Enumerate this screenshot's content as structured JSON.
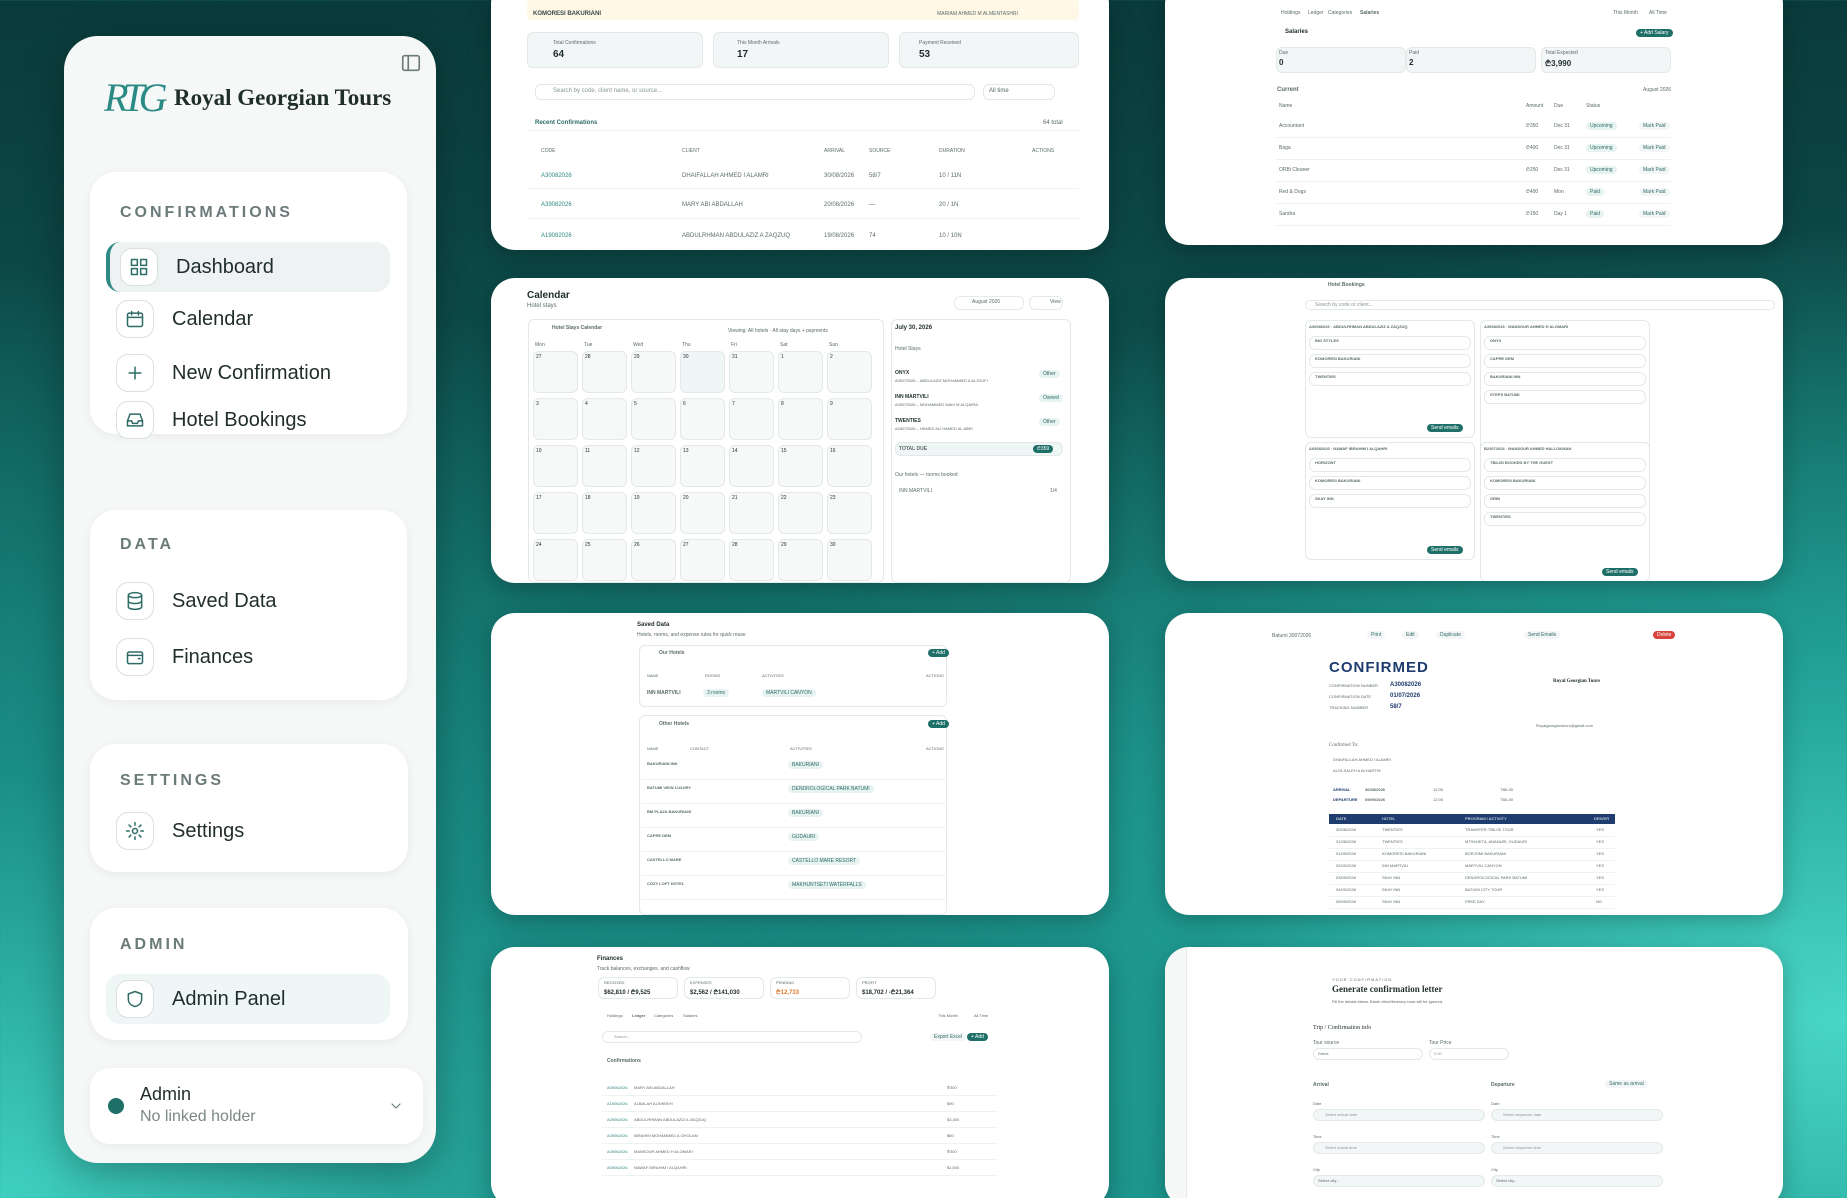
{
  "sidebar": {
    "brand": "Royal Georgian Tours",
    "logo_text": "RTG",
    "groups": [
      {
        "title": "CONFIRMATIONS",
        "items": [
          "Dashboard",
          "Calendar",
          "New Confirmation",
          "Hotel Bookings"
        ]
      },
      {
        "title": "DATA",
        "items": [
          "Saved Data",
          "Finances"
        ]
      },
      {
        "title": "SETTINGS",
        "items": [
          "Settings"
        ]
      },
      {
        "title": "ADMIN",
        "items": [
          "Admin Panel"
        ]
      }
    ],
    "user": {
      "name": "Admin",
      "subtitle": "No linked holder"
    }
  },
  "dashboard": {
    "banner": "KOMORESI BAKURIANI",
    "banner_right": "MARIAM AHMED M ALMENTASHRI",
    "stats": [
      {
        "label": "Total Confirmations",
        "value": "64"
      },
      {
        "label": "This Month Arrivals",
        "value": "17"
      },
      {
        "label": "Payment Received",
        "value": "53"
      }
    ],
    "search_placeholder": "Search by code, client name, or source...",
    "range": "All time",
    "section": "Recent Confirmations",
    "total": "64 total",
    "columns": [
      "CODE",
      "CLIENT",
      "ARRIVAL",
      "SOURCE",
      "DURATION",
      "ACTIONS"
    ],
    "rows": [
      [
        "A30082026",
        "DHAIFALLAH AHMED I ALAMRI",
        "30/08/2026",
        "58/7",
        "10 / 11N"
      ],
      [
        "A39082026",
        "MARY ABI ABDALLAH",
        "20/08/2026",
        "—",
        "20 / 1N"
      ],
      [
        "A19082026",
        "ABDULRHMAN ABDULAZIZ A ZAQZUQ",
        "19/08/2026",
        "74",
        "10 / 10N"
      ]
    ]
  },
  "salaries": {
    "tabs": [
      "Holdings",
      "Ledger",
      "Categories",
      "Salaries"
    ],
    "title": "Salaries",
    "add": "+ Add Salary",
    "range": [
      "This Month",
      "All Time"
    ],
    "stats": [
      {
        "label": "Due",
        "value": "0"
      },
      {
        "label": "Paid",
        "value": "2"
      },
      {
        "label": "Total Expected",
        "value": "₾3,990"
      }
    ],
    "section": "Current",
    "month": "August 2026",
    "columns": [
      "Name",
      "Amount",
      "Due",
      "Status"
    ],
    "rows": [
      [
        "Accountant",
        "₾350",
        "Dec 31",
        "Upcoming",
        "Mark Paid"
      ],
      [
        "Baga",
        "₾400",
        "Dec 31",
        "Upcoming",
        "Mark Paid"
      ],
      [
        "ORBi Cleaner",
        "₾250",
        "Dec 31",
        "Upcoming",
        "Mark Paid"
      ],
      [
        "Red & Dogs",
        "₾400",
        "Mon",
        "Paid",
        "Mark Paid"
      ],
      [
        "Sandra",
        "₾150",
        "Day 1",
        "Paid",
        "Mark Paid"
      ]
    ]
  },
  "calendar": {
    "title": "Calendar",
    "subtitle": "Hotel stays",
    "month": "August 2026",
    "view": "View",
    "panel_title": "Hotel Stays Calendar",
    "viewing": "Viewing: All hotels · All stay days + payments",
    "weekdays": [
      "Mon",
      "Tue",
      "Wed",
      "Thu",
      "Fri",
      "Sat",
      "Sun"
    ],
    "days": [
      "27",
      "28",
      "29",
      "30",
      "31",
      "1",
      "2",
      "3",
      "4",
      "5",
      "6",
      "7",
      "8",
      "9",
      "10",
      "11",
      "12",
      "13",
      "14",
      "15",
      "16",
      "17",
      "18",
      "19",
      "20",
      "21",
      "22",
      "23",
      "24",
      "25",
      "26",
      "27",
      "28",
      "29",
      "30"
    ],
    "side_date": "July 30, 2026",
    "side_section": "Hotel Stays",
    "stays": [
      [
        "ONYX",
        "A30070026 – ABDULAZIZ MOHAMMED A ALJOUFI",
        "Other"
      ],
      [
        "INN MARTVILI",
        "A39070026 – MOHAMMED MAKI M ALQARNI",
        "Owned"
      ],
      [
        "TWENTIES",
        "A28070026 – HAMED ALI HAMED AL ABRI",
        "Other"
      ]
    ],
    "total_label": "TOTAL DUE",
    "total_value": "₾359",
    "rooms_title": "Our hotels — rooms booked",
    "rooms_hotel": "INN MARTVILI",
    "rooms_value": "1/4"
  },
  "hotel_bookings": {
    "title": "Hotel Bookings",
    "search": "Search by code or client...",
    "send": "Send emails",
    "groups": [
      {
        "head": "A30082026 · ABDULRHMAN ABDULAZIZ A ZAQZUQ",
        "hotels": [
          "BIG STYLES",
          "KOMORESI BAKURIANI",
          "TWENTIES"
        ]
      },
      {
        "head": "A39082026 · MANSOUR AHMED H ALOMARI",
        "hotels": [
          "ONYX",
          "CAPRE DEM",
          "BAKURIANI INN",
          "STEPS BATUMI"
        ]
      },
      {
        "head": "A93082026 · NAWAF IBRAHIM I ALQAHRI",
        "hotels": [
          "HORIZONT",
          "KOMORESI BAKURIANI",
          "SKAY INN"
        ]
      },
      {
        "head": "B23072026 · MANSOUR AHMED HALLOKMAN",
        "hotels": [
          "TBILISI BOOKED BY THE GUEST",
          "KOMORESI BAKURIANI",
          "ORBI",
          "TWENTIES"
        ]
      }
    ]
  },
  "saved_data": {
    "title": "Saved Data",
    "subtitle": "Hotels, rooms, and expense rules for quick reuse",
    "our": "Our Hotels",
    "other": "Other Hotels",
    "add": "+ Add",
    "cols": [
      "NAME",
      "ROOMS",
      "ACTIVITIES",
      "ACTIONS"
    ],
    "cols2": [
      "NAME",
      "CONTACT",
      "ACTIVITIES",
      "ACTIONS"
    ],
    "our_rows": [
      [
        "INN MARTVILI",
        "3 rooms",
        "MARTVILI CANYON"
      ]
    ],
    "other_rows": [
      [
        "BAKURIANI INN",
        "BAKURIANI"
      ],
      [
        "BATUMI VIEW LUXURY",
        "DENDROLOGICAL PARK BATUMI"
      ],
      [
        "BM PLAZA BAKURIANI",
        "BAKURIANI"
      ],
      [
        "CAPRE DEM",
        "GUDAURI"
      ],
      [
        "CASTELLO MARE",
        "CASTELLO MARE RESORT"
      ],
      [
        "COZY LOFT HOTEL",
        "MAKHUNTSETI WATERFALLS"
      ]
    ]
  },
  "letter": {
    "back": "Batumi 30072026",
    "actions": [
      "Print",
      "Edit",
      "Duplicate",
      "Send Emails",
      "Delete"
    ],
    "title": "CONFIRMED",
    "fields": [
      [
        "CONFIRMATION NUMBER",
        "A30082026"
      ],
      [
        "CONFIRMATION DATE",
        "01/07/2026"
      ],
      [
        "TRACKING NUMBER",
        "58/7"
      ]
    ],
    "company": "Royal Georgian Tours",
    "email": "Royalgeorgiantours@gmail.com",
    "confirmed_to": "Confirmed To:",
    "clients": [
      "DHAIFALLAH AHMED I ALAMRI",
      "ALYA SALEH A ALHARTHI"
    ],
    "arrival": [
      "ARRIVAL",
      "30/08/2026",
      "12:05",
      "TBILISI"
    ],
    "departure": [
      "DEPARTURE",
      "09/09/2026",
      "12:05",
      "TBILISI"
    ],
    "cols": [
      "DATE",
      "HOTEL",
      "PROGRAM / ACTIVITY",
      "DRIVER"
    ],
    "rows": [
      [
        "30/08/2026",
        "TWENTIES",
        "TRANSFER-TBILISI TOUR",
        "YES"
      ],
      [
        "31/08/2026",
        "TWENTIES",
        "MTSKHETA, ANANURI, GUDAURI",
        "YES"
      ],
      [
        "01/09/2026",
        "KOMORESI BAKURIANI",
        "BORJOMI BAKURIANI",
        "YES"
      ],
      [
        "02/09/2026",
        "INN MARTVILI",
        "MARTVILI CANYON",
        "YES"
      ],
      [
        "03/09/2026",
        "SKAY INN",
        "DENDROLOGICAL PARK BATUMI",
        "YES"
      ],
      [
        "04/09/2026",
        "SKAY INN",
        "BATUMI CITY TOUR",
        "YES"
      ],
      [
        "05/09/2026",
        "SKAY INN",
        "FREE DAY",
        "NO"
      ]
    ]
  },
  "finances": {
    "title": "Finances",
    "subtitle": "Track balances, exchanges, and cashflow",
    "stats": [
      {
        "label": "RECEIVED",
        "value": "$62,810 / ₾9,525"
      },
      {
        "label": "EXPENSES",
        "value": "$2,562 / ₾141,030"
      },
      {
        "label": "PENDING",
        "value": "₾12,733"
      },
      {
        "label": "PROFIT",
        "value": "$18,702 / -₾21,364"
      }
    ],
    "tabs": [
      "Holdings",
      "Ledger",
      "Categories",
      "Salaries"
    ],
    "range": [
      "This Month",
      "All Time"
    ],
    "search": "Search...",
    "export": "Export Excel",
    "add": "+ Add",
    "section": "Confirmations",
    "rows": [
      [
        "A09082026",
        "MARY ABI ABDALLAH",
        "₾300"
      ],
      [
        "A19082026",
        "ALBALAH ALSHEIKH",
        "$90"
      ],
      [
        "A29082026",
        "ABDULRHMAN ABDULAZIZ A ZAQZUQ",
        "$3,300"
      ],
      [
        "A39082026",
        "IBRAHIM MOHAMMED A GHOLAM",
        "$60"
      ],
      [
        "A49082026",
        "MANSOUR AHMED H ALOMARI",
        "₾300"
      ],
      [
        "A59082026",
        "NAWAF IBRAHIM I ALQAHRI",
        "$1,500"
      ]
    ]
  },
  "new_conf": {
    "eyebrow": "YOUR CONFIRMATION",
    "title": "Generate confirmation letter",
    "hint": "Fill the details below. Blank client/itinerary rows will be ignored.",
    "section": "Trip / Confirmation info",
    "tour_source": "Tour source",
    "tour_source_value": "Direct",
    "tour_price": "Tour Price",
    "tour_price_value": "0.00",
    "arrival": "Arrival",
    "departure": "Departure",
    "same": "Same as arrival",
    "date": "Date",
    "date_ph": "Select arrival date",
    "date_ph2": "Select departure date",
    "time": "Time",
    "time_ph": "Select arrival time",
    "time_ph2": "Select departure time",
    "city": "City",
    "city_ph": "Select city..."
  },
  "colors": {
    "accent": "#1f6f69",
    "brand": "#2d8a84",
    "danger": "#d9443a"
  }
}
